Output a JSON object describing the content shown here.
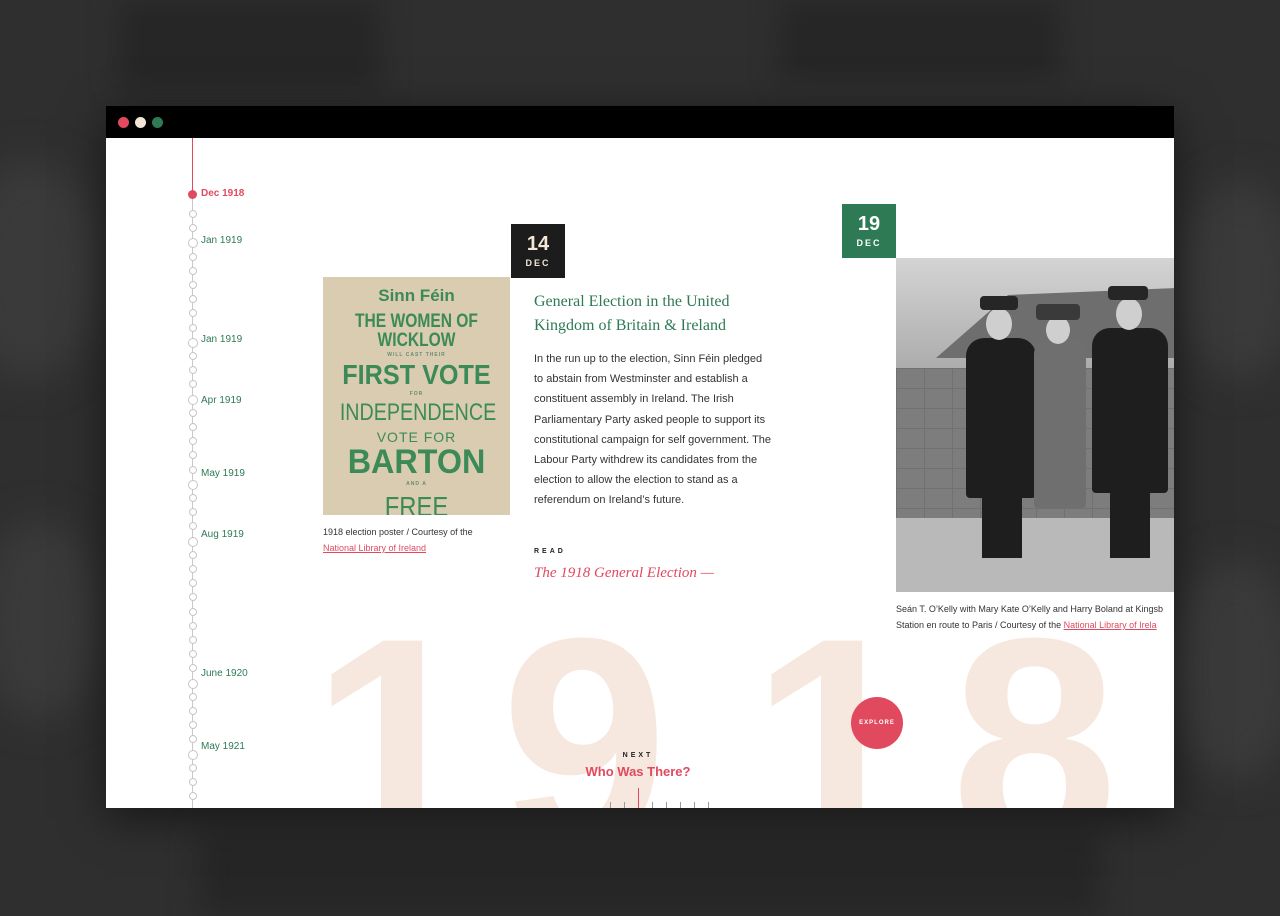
{
  "colors": {
    "accent": "#e1495f",
    "green": "#2e7a55",
    "cream": "#f3e6d6",
    "year_watermark": "#f6e8df"
  },
  "window": {
    "controls": [
      "close-dot",
      "minimize-dot",
      "maximize-dot"
    ]
  },
  "timeline": {
    "items": [
      {
        "label": "Dec 1918",
        "active": true
      },
      {
        "label": "Jan 1919"
      },
      {
        "label": "Jan 1919"
      },
      {
        "label": "Apr 1919"
      },
      {
        "label": "May 1919"
      },
      {
        "label": "Aug 1919"
      },
      {
        "label": "June 1920"
      },
      {
        "label": "May 1921"
      }
    ]
  },
  "background_year": {
    "digits": [
      "1",
      "9",
      "1",
      "8"
    ]
  },
  "entry1": {
    "date_day": "14",
    "date_month": "DEC",
    "poster": {
      "line1": "Sinn Féin",
      "line2": "THE WOMEN OF WICKLOW",
      "line3": "WILL CAST THEIR",
      "line4": "FIRST VOTE",
      "line5": "FOR",
      "line6": "INDEPENDENCE",
      "line7": "VOTE FOR",
      "line8": "BARTON",
      "line9": "AND A",
      "line10": "FREE IRELAND"
    },
    "caption_text": "1918 election poster / Courtesy of the",
    "caption_link": "National Library of Ireland",
    "title": "General Election in the United Kingdom of Britain & Ireland",
    "body": "In the run up to the election, Sinn Féin pledged to abstain from Westminster and establish a constituent assembly in Ireland. The Irish Parliamentary Party asked people to support its constitutional campaign for self government. The Labour Party withdrew its candidates from the election to allow the election to stand as a referendum on Ireland’s future.",
    "read_label": "READ",
    "read_link": "The 1918 General Election —"
  },
  "entry2": {
    "date_day": "19",
    "date_month": "DEC",
    "caption_line1": "Seán T. O’Kelly with Mary Kate O’Kelly and Harry Boland at Kingsb",
    "caption_line2_text": "Station en route to Paris / Courtesy of the",
    "caption_link": "National Library of Irela"
  },
  "explore_button": "EXPLORE",
  "next": {
    "label": "NEXT",
    "link": "Who Was There?"
  }
}
